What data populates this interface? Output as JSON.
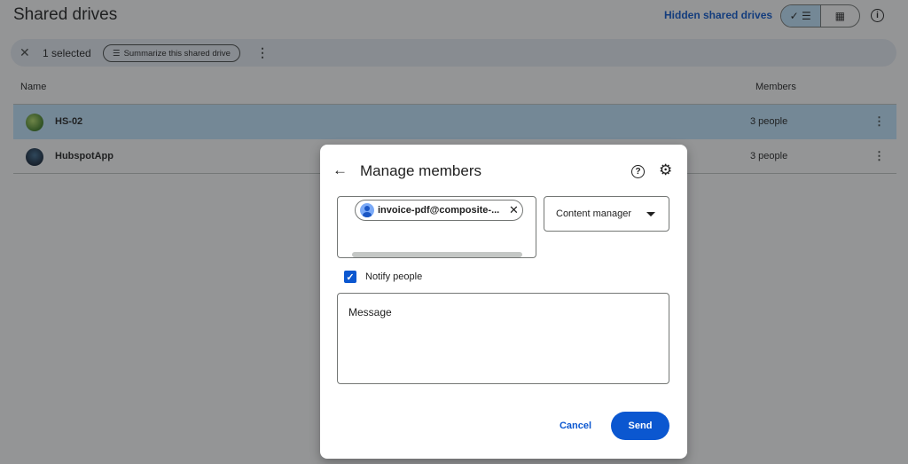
{
  "page": {
    "title": "Shared drives",
    "hidden_link": "Hidden shared drives",
    "view_list_icon": "✓ ☰",
    "view_grid_icon": "▦"
  },
  "selection": {
    "count_label": "1 selected",
    "summarize_label": "Summarize this shared drive"
  },
  "table": {
    "columns": {
      "name": "Name",
      "members": "Members"
    },
    "rows": [
      {
        "name": "HS-02",
        "members": "3 people",
        "selected": true
      },
      {
        "name": "HubspotApp",
        "members": "3 people",
        "selected": false
      }
    ]
  },
  "dialog": {
    "title": "Manage members",
    "chip_email": "invoice-pdf@composite-...",
    "role": "Content manager",
    "notify_label": "Notify people",
    "notify_checked": true,
    "message_placeholder": "Message",
    "cancel_label": "Cancel",
    "send_label": "Send"
  },
  "colors": {
    "accent": "#0b57d0",
    "selected_row": "#c2e7ff",
    "selection_bar": "#e9eef6"
  }
}
